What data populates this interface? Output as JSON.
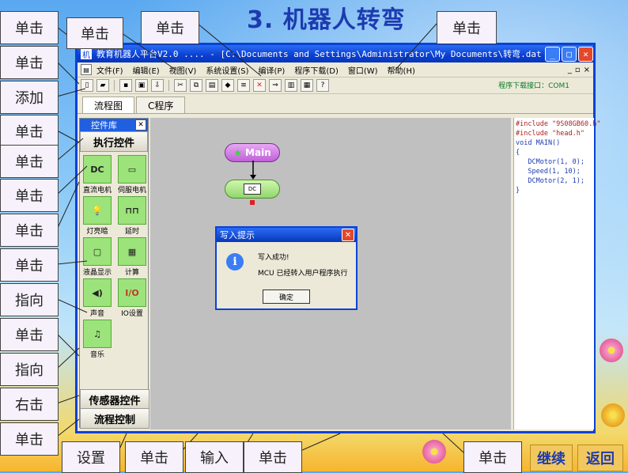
{
  "slide": {
    "title": "3. 机器人转弯",
    "nav": {
      "continue_label": "继续",
      "back_label": "返回"
    }
  },
  "callouts": {
    "top": [
      {
        "id": "c-top-1",
        "label": "单击"
      },
      {
        "id": "c-top-2",
        "label": "单击"
      },
      {
        "id": "c-top-3",
        "label": "单击"
      },
      {
        "id": "c-top-4",
        "label": "单击"
      }
    ],
    "left": [
      {
        "id": "c-left-1",
        "label": "单击"
      },
      {
        "id": "c-left-2",
        "label": "添加"
      },
      {
        "id": "c-left-3",
        "label": "单击"
      },
      {
        "id": "c-left-4",
        "label": "单击"
      },
      {
        "id": "c-left-5",
        "label": "单击"
      },
      {
        "id": "c-left-6",
        "label": "单击"
      },
      {
        "id": "c-left-7",
        "label": "单击"
      },
      {
        "id": "c-left-8",
        "label": "指向"
      },
      {
        "id": "c-left-9",
        "label": "单击"
      },
      {
        "id": "c-left-10",
        "label": "指向"
      },
      {
        "id": "c-left-11",
        "label": "右击"
      },
      {
        "id": "c-left-12",
        "label": "单击"
      }
    ],
    "bottom": [
      {
        "id": "c-bot-1",
        "label": "设置"
      },
      {
        "id": "c-bot-2",
        "label": "单击"
      },
      {
        "id": "c-bot-3",
        "label": "输入"
      },
      {
        "id": "c-bot-4",
        "label": "单击"
      },
      {
        "id": "c-bot-5",
        "label": "单击"
      }
    ]
  },
  "window": {
    "app_icon": "机",
    "title": "教育机器人平台V2.0 .... - [C:\\Documents and Settings\\Administrator\\My Documents\\转弯.dat -...",
    "menu": [
      "文件(F)",
      "编辑(E)",
      "视图(V)",
      "系统设置(S)",
      "编译(P)",
      "程序下载(D)",
      "窗口(W)",
      "帮助(H)"
    ],
    "port_label": "程序下载接口：COM1",
    "tabs": [
      "流程图",
      "C程序"
    ]
  },
  "palette": {
    "header": "控件库",
    "category_exec": "执行控件",
    "components": [
      {
        "icon": "DC",
        "label": "直流电机"
      },
      {
        "icon": "▭",
        "label": "伺服电机"
      },
      {
        "icon": "💡",
        "label": "灯亮暗"
      },
      {
        "icon": "⊓⊓",
        "label": "延时"
      },
      {
        "icon": "▢",
        "label": "液晶显示"
      },
      {
        "icon": "▦",
        "label": "计算"
      },
      {
        "icon": "◀)",
        "label": "声音"
      },
      {
        "icon": "I/O",
        "label": "IO设置"
      },
      {
        "icon": "♫",
        "label": "音乐"
      }
    ],
    "category_sensor": "传感器控件",
    "category_flow": "流程控制"
  },
  "canvas": {
    "main_label": "Main",
    "dc_label": "DC"
  },
  "code_lines": [
    "#include \"9S08GB60.h\"",
    "#include \"head.h\"",
    "void MAIN()",
    "{",
    "   DCMotor(1, 0);",
    "   Speed(1, 10);",
    "   DCMotor(2, 1);",
    "}"
  ],
  "dialog": {
    "title": "写入提示",
    "message1": "写入成功!",
    "message2": "MCU 已经转入用户程序执行",
    "ok_label": "确定"
  }
}
